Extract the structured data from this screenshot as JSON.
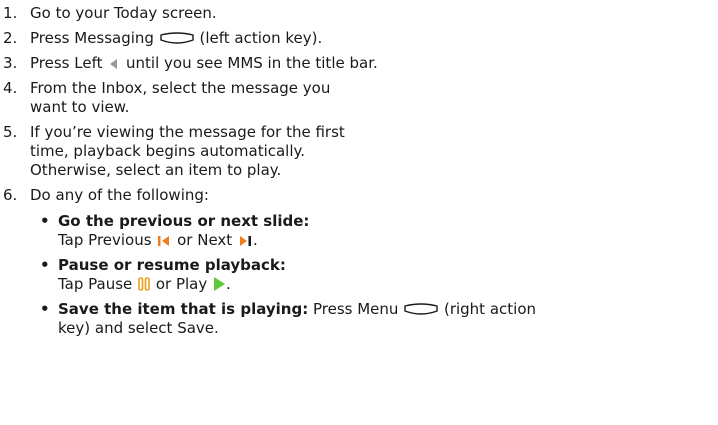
{
  "steps": [
    {
      "num": "1.",
      "lines": [
        "Go to your Today screen."
      ]
    },
    {
      "num": "2.",
      "pre": "Press Messaging",
      "post": " (left action key)."
    },
    {
      "num": "3.",
      "pre": "Press Left",
      "post": " until you see MMS in the title bar."
    },
    {
      "num": "4.",
      "lines": [
        "From the Inbox, select the message you",
        "want to view."
      ]
    },
    {
      "num": "5.",
      "lines": [
        "If you’re viewing the message for the first",
        "time, playback begins automatically.",
        "Otherwise, select an item to play."
      ]
    },
    {
      "num": "6.",
      "lines": [
        "Do any of the following:"
      ]
    }
  ],
  "bullets": [
    {
      "heading": "Go the previous or next slide:",
      "pre": "Tap Previous",
      "mid": " or Next",
      "post": "."
    },
    {
      "heading": "Pause or resume playback:",
      "pre": "Tap Pause",
      "mid": " or Play",
      "post": "."
    },
    {
      "heading": "Save the item that is playing:",
      "pre": " Press Menu",
      "post": " (right action",
      "line2": "key) and select Save."
    }
  ],
  "icons": {
    "messaging": "left-action-key-icon",
    "left": "left-arrow-icon",
    "previous": "previous-icon",
    "next": "next-icon",
    "pause": "pause-icon",
    "play": "play-icon",
    "menu": "right-action-key-icon"
  },
  "colors": {
    "text": "#1a1a1a",
    "media_icon": "#f07c1e",
    "pause_icon": "#e8a020",
    "play_icon": "#5cc83a"
  }
}
